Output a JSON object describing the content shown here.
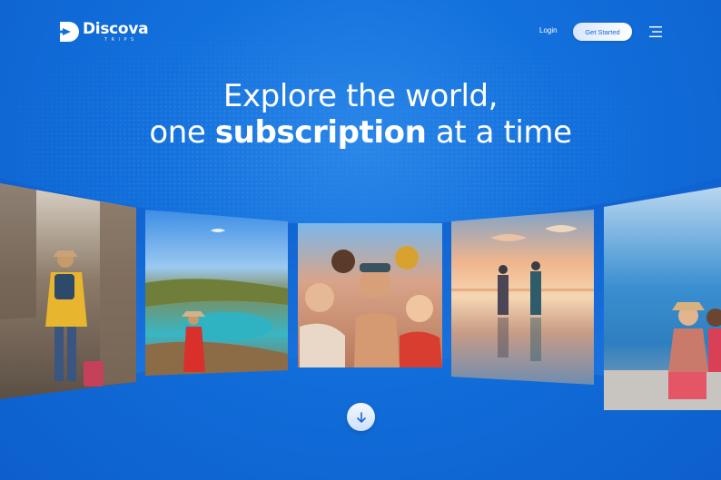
{
  "brand": {
    "name": "Discova",
    "tagline": "TRIPS",
    "accent": "#1270dc",
    "cta_bg": "#ffffff"
  },
  "nav": {
    "login_label": "Login",
    "cta_label": "Get Started",
    "menu_icon": "hamburger-menu-icon"
  },
  "hero": {
    "line1": "Explore the world,",
    "line2_pre": "one ",
    "line2_bold": "subscription",
    "line2_post": " at a time"
  },
  "gallery": {
    "images": [
      "traveler-with-suitcase-old-street",
      "woman-on-hilltop-above-bay",
      "group-selfie-friends",
      "couple-at-sunset-infinity-pool",
      "two-women-by-seaside"
    ]
  },
  "scroll": {
    "icon": "arrow-down-icon"
  }
}
